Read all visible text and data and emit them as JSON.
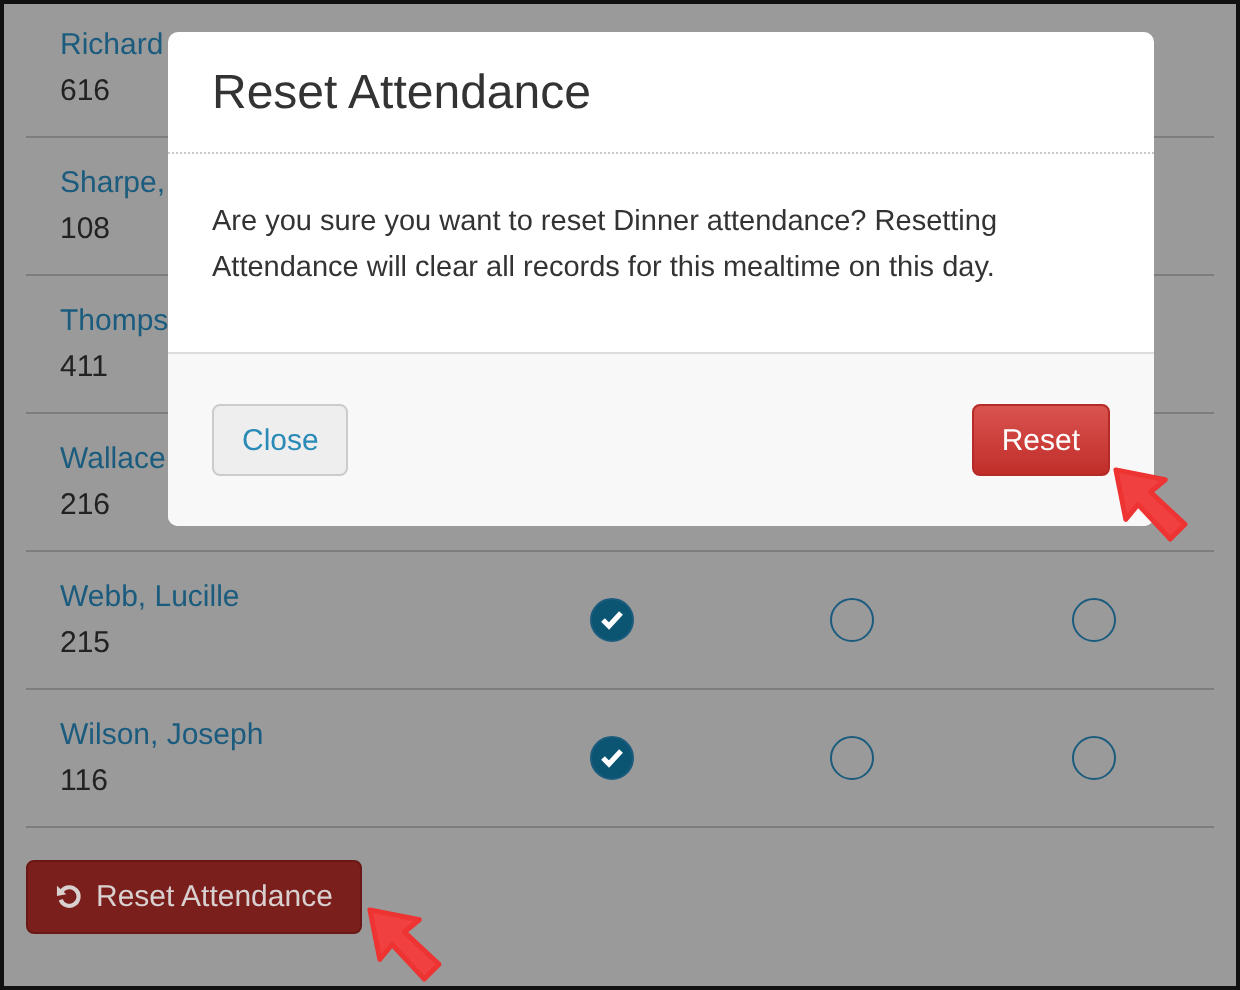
{
  "rows": [
    {
      "name": "Richard",
      "number": "616"
    },
    {
      "name": "Sharpe,",
      "number": "108"
    },
    {
      "name": "Thomps",
      "number": "411"
    },
    {
      "name": "Wallace",
      "number": "216"
    },
    {
      "name": "Webb, Lucille",
      "number": "215",
      "attendance": [
        {
          "checked": true
        },
        {
          "checked": false
        },
        {
          "checked": false
        }
      ]
    },
    {
      "name": "Wilson, Joseph",
      "number": "116",
      "attendance": [
        {
          "checked": true
        },
        {
          "checked": false
        },
        {
          "checked": false
        }
      ]
    }
  ],
  "reset_button": {
    "label": "Reset Attendance"
  },
  "modal": {
    "title": "Reset Attendance",
    "message": "Are you sure you want to reset Dinner attendance? Resetting Attendance will clear all records for this mealtime on this day.",
    "buttons": [
      {
        "label": "Close",
        "kind": "default"
      },
      {
        "label": "Reset",
        "kind": "danger"
      }
    ]
  }
}
